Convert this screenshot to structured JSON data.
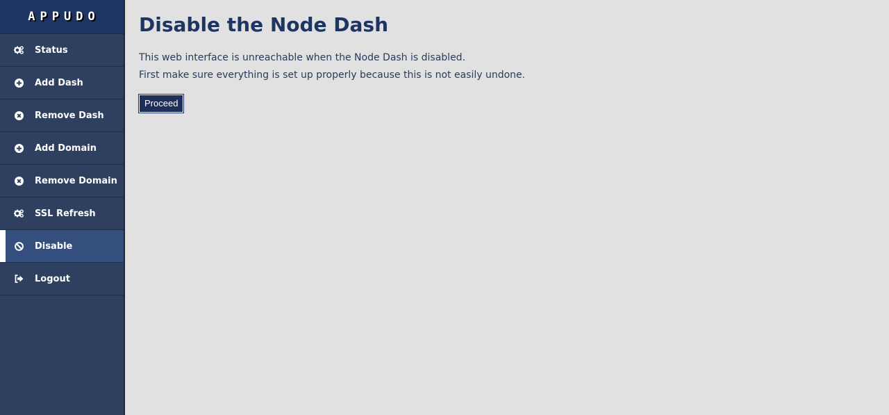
{
  "brand": {
    "title": "APPUDO"
  },
  "sidebar": {
    "items": [
      {
        "label": "Status",
        "icon": "gears-icon",
        "active": false
      },
      {
        "label": "Add Dash",
        "icon": "plus-circle-icon",
        "active": false
      },
      {
        "label": "Remove Dash",
        "icon": "times-circle-icon",
        "active": false
      },
      {
        "label": "Add Domain",
        "icon": "plus-circle-icon",
        "active": false
      },
      {
        "label": "Remove Domain",
        "icon": "times-circle-icon",
        "active": false
      },
      {
        "label": "SSL Refresh",
        "icon": "gears-icon",
        "active": false
      },
      {
        "label": "Disable",
        "icon": "ban-icon",
        "active": true
      },
      {
        "label": "Logout",
        "icon": "sign-out-icon",
        "active": false
      }
    ]
  },
  "main": {
    "title": "Disable the Node Dash",
    "paragraph1": "This web interface is unreachable when the Node Dash is disabled.",
    "paragraph2": "First make sure everything is set up properly because this is not easily undone.",
    "proceed_label": "Proceed"
  },
  "colors": {
    "sidebar_bg": "#2e3f5f",
    "brand_bg": "#1e3463",
    "active_bg": "#344f7d",
    "page_bg": "#e1e1e1",
    "heading": "#1e3461",
    "button_bg": "#1e2f5a"
  }
}
